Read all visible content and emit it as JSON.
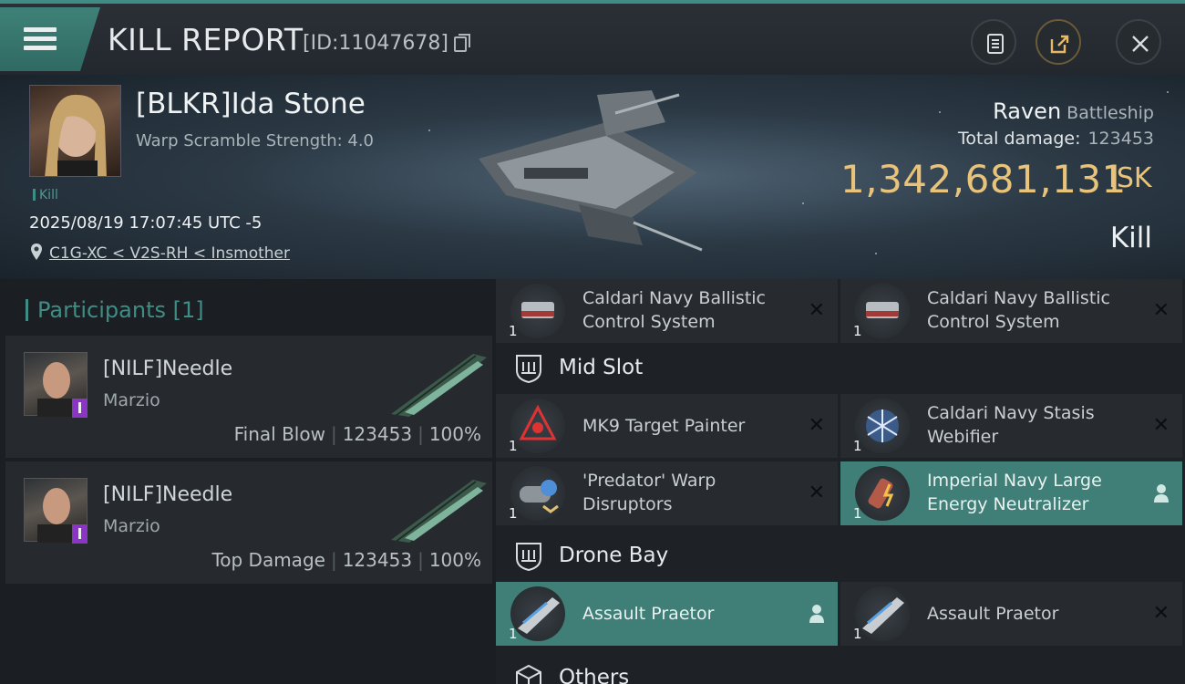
{
  "header": {
    "title": "KILL REPORT",
    "report_id": "[ID:11047678]"
  },
  "victim": {
    "name": "[BLKR]Ida Stone",
    "warp_scramble": "Warp Scramble Strength: 4.0",
    "kill_tag": "Kill",
    "timestamp": "2025/08/19 17:07:45 UTC -5",
    "location": "C1G-XC < V2S-RH < Insmother",
    "ship_name": "Raven",
    "ship_class": "Battleship",
    "total_damage_label": "Total damage:",
    "total_damage": "123453",
    "isk_value": "1,342,681,131",
    "isk_unit": "ISK",
    "result": "Kill"
  },
  "participants": {
    "heading": "Participants [1]",
    "items": [
      {
        "name": "[NILF]Needle",
        "corp": "Marzio",
        "role": "Final Blow",
        "damage": "123453",
        "percent": "100%"
      },
      {
        "name": "[NILF]Needle",
        "corp": "Marzio",
        "role": "Top Damage",
        "damage": "123453",
        "percent": "100%"
      }
    ]
  },
  "fittings": {
    "low_slots": [
      {
        "name_1": "Caldari Navy Ballistic",
        "name_2": "Control System",
        "qty": "1",
        "highlight": false
      },
      {
        "name_1": "Caldari Navy Ballistic",
        "name_2": "Control System",
        "qty": "1",
        "highlight": false
      }
    ],
    "mid_slot_title": "Mid Slot",
    "mid_slots": [
      {
        "name_1": "MK9 Target Painter",
        "name_2": "",
        "qty": "1",
        "highlight": false
      },
      {
        "name_1": "Caldari Navy Stasis",
        "name_2": "Webifier",
        "qty": "1",
        "highlight": false
      },
      {
        "name_1": "'Predator' Warp",
        "name_2": "Disruptors",
        "qty": "1",
        "highlight": false
      },
      {
        "name_1": "Imperial Navy Large",
        "name_2": "Energy Neutralizer",
        "qty": "1",
        "highlight": true
      }
    ],
    "drone_bay_title": "Drone Bay",
    "drones": [
      {
        "name_1": "Assault Praetor",
        "name_2": "",
        "qty": "1",
        "highlight": true
      },
      {
        "name_1": "Assault Praetor",
        "name_2": "",
        "qty": "1",
        "highlight": false
      }
    ],
    "others_title": "Others",
    "destroyed_mark": "✕"
  },
  "colors": {
    "accent": "#3f8d85",
    "isk": "#e9c37a",
    "highlight_slot": "#3f7f77"
  },
  "icons": [
    "menu-icon",
    "copy-icon",
    "clipboard-icon",
    "share-icon",
    "close-icon",
    "location-pin-icon",
    "shield-icon",
    "pilot-icon"
  ]
}
